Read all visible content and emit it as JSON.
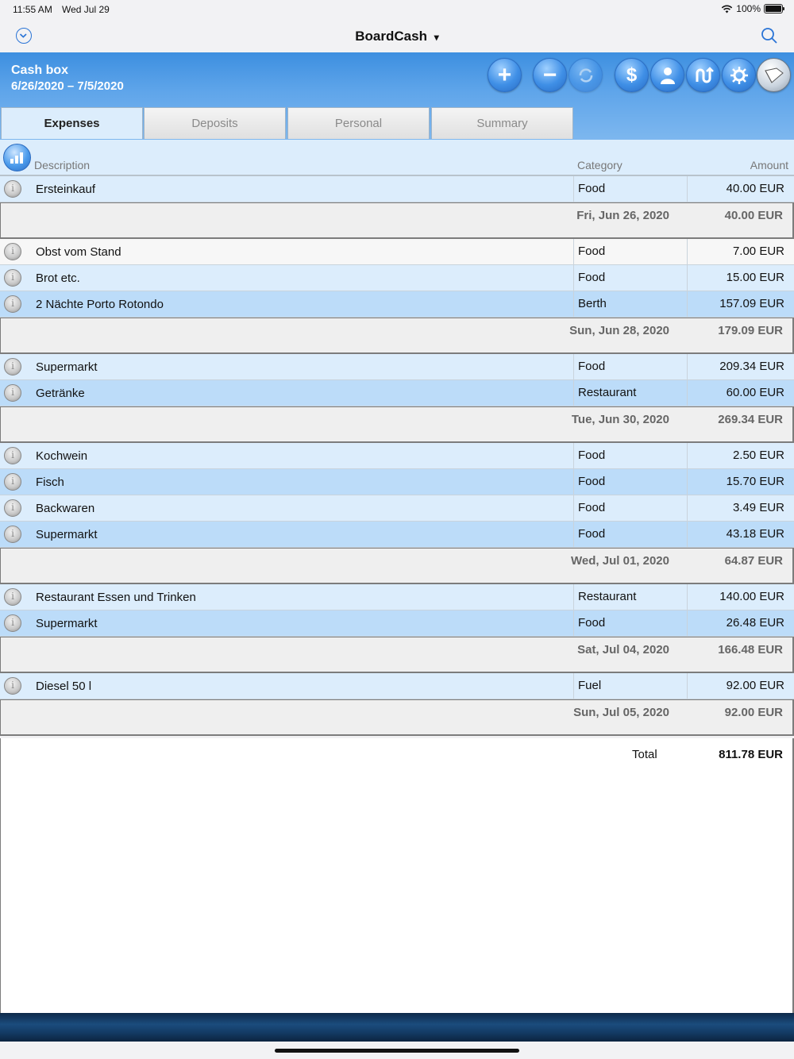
{
  "status": {
    "time": "11:55 AM",
    "date": "Wed Jul 29",
    "battery": "100%"
  },
  "nav": {
    "title": "BoardCash",
    "caret": "▾"
  },
  "header": {
    "title": "Cash box",
    "range": "6/26/2020 – 7/5/2020"
  },
  "toolbar": {
    "add": "+",
    "remove": "−",
    "dollar": "$"
  },
  "tabs": [
    "Expenses",
    "Deposits",
    "Personal",
    "Summary"
  ],
  "columns": {
    "description": "Description",
    "category": "Category",
    "amount": "Amount"
  },
  "groups": [
    {
      "rows": [
        {
          "desc": "Ersteinkauf",
          "cat": "Food",
          "amt": "40.00 EUR"
        }
      ],
      "date": "Fri, Jun 26, 2020",
      "sum": "40.00 EUR"
    },
    {
      "rows": [
        {
          "desc": "Obst vom Stand",
          "cat": "Food",
          "amt": "7.00 EUR"
        },
        {
          "desc": "Brot etc.",
          "cat": "Food",
          "amt": "15.00 EUR"
        },
        {
          "desc": "2 Nächte Porto Rotondo",
          "cat": "Berth",
          "amt": "157.09 EUR"
        }
      ],
      "date": "Sun, Jun 28, 2020",
      "sum": "179.09 EUR"
    },
    {
      "rows": [
        {
          "desc": "Supermarkt",
          "cat": "Food",
          "amt": "209.34 EUR"
        },
        {
          "desc": "Getränke",
          "cat": "Restaurant",
          "amt": "60.00 EUR"
        }
      ],
      "date": "Tue, Jun 30, 2020",
      "sum": "269.34 EUR"
    },
    {
      "rows": [
        {
          "desc": "Kochwein",
          "cat": "Food",
          "amt": "2.50 EUR"
        },
        {
          "desc": "Fisch",
          "cat": "Food",
          "amt": "15.70 EUR"
        },
        {
          "desc": "Backwaren",
          "cat": "Food",
          "amt": "3.49 EUR"
        },
        {
          "desc": "Supermarkt",
          "cat": "Food",
          "amt": "43.18 EUR"
        }
      ],
      "date": "Wed, Jul 01, 2020",
      "sum": "64.87 EUR"
    },
    {
      "rows": [
        {
          "desc": "Restaurant Essen und Trinken",
          "cat": "Restaurant",
          "amt": "140.00 EUR"
        },
        {
          "desc": "Supermarkt",
          "cat": "Food",
          "amt": "26.48 EUR"
        }
      ],
      "date": "Sat, Jul 04, 2020",
      "sum": "166.48 EUR"
    },
    {
      "rows": [
        {
          "desc": "Diesel 50 l",
          "cat": "Fuel",
          "amt": "92.00 EUR"
        }
      ],
      "date": "Sun, Jul 05, 2020",
      "sum": "92.00 EUR"
    }
  ],
  "total": {
    "label": "Total",
    "value": "811.78 EUR"
  },
  "colors": {
    "accent": "#2a74d6",
    "row_light": "#dcedfc",
    "row_medium": "#bcdcf9"
  }
}
